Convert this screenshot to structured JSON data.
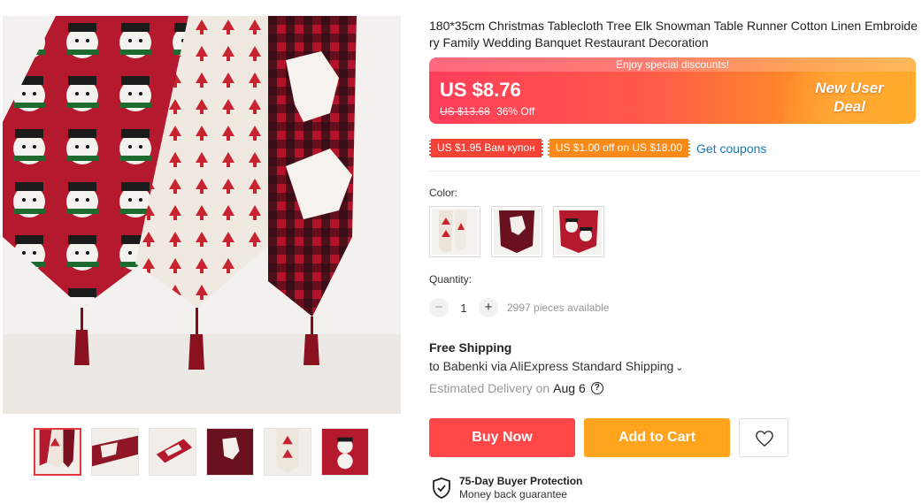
{
  "product": {
    "title": "180*35cm Christmas Tablecloth Tree Elk Snowman Table Runner Cotton Linen Embroidery Family Wedding Banquet Restaurant Decoration"
  },
  "price_banner": {
    "strip_text": "Enjoy special discounts!",
    "price": "US $8.76",
    "old_price": "US $13.68",
    "discount": "36% Off",
    "deal_line1": "New User",
    "deal_line2": "Deal",
    "gradient_start": "#ff3d5a",
    "gradient_end": "#ffa52a"
  },
  "coupons": {
    "items": [
      {
        "label": "US $1.95 Вам купон",
        "color": "#f44336"
      },
      {
        "label": "US $1.00 off on US $18.00",
        "color": "#fc8a19"
      }
    ],
    "get_coupons_label": "Get coupons"
  },
  "options": {
    "color_label": "Color:",
    "swatches": [
      {
        "name": "white-red"
      },
      {
        "name": "red-plaid"
      },
      {
        "name": "snowman-red"
      }
    ]
  },
  "quantity": {
    "label": "Quantity:",
    "minus": "−",
    "plus": "+",
    "value": "1",
    "available": "2997 pieces available"
  },
  "shipping": {
    "title": "Free Shipping",
    "line": "to Babenki via AliExpress Standard Shipping",
    "chevron": "⌄",
    "delivery_label": "Estimated Delivery on",
    "delivery_date": "Aug 6",
    "help_icon": "?"
  },
  "actions": {
    "buy_now": "Buy Now",
    "add_to_cart": "Add to Cart",
    "buy_color": "#ff4747",
    "cart_color": "#ffa41c"
  },
  "protection": {
    "title": "75-Day Buyer Protection",
    "subtitle": "Money back guarantee"
  },
  "gallery": {
    "thumbnails": [
      {
        "name": "thumb-1",
        "active": true
      },
      {
        "name": "thumb-2",
        "active": false
      },
      {
        "name": "thumb-3",
        "active": false
      },
      {
        "name": "thumb-4",
        "active": false
      },
      {
        "name": "thumb-5",
        "active": false
      },
      {
        "name": "thumb-6",
        "active": false
      }
    ]
  }
}
